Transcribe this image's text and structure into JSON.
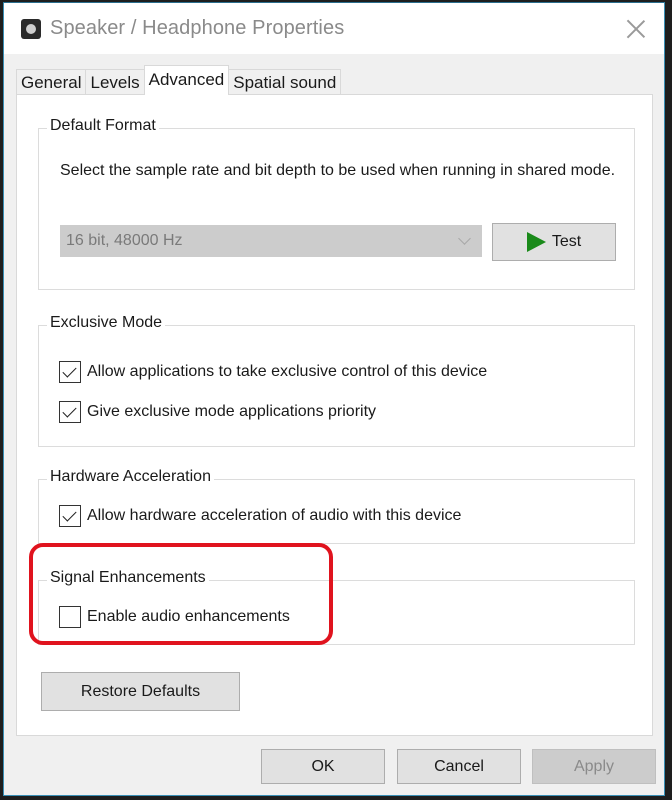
{
  "window": {
    "title": "Speaker / Headphone Properties",
    "icon": "speaker-icon",
    "close_icon": "close-icon"
  },
  "tabs": [
    {
      "label": "General",
      "active": false
    },
    {
      "label": "Levels",
      "active": false
    },
    {
      "label": "Advanced",
      "active": true
    },
    {
      "label": "Spatial sound",
      "active": false
    }
  ],
  "default_format": {
    "label": "Default Format",
    "description": "Select the sample rate and bit depth to be used when running in shared mode.",
    "select_value": "16 bit, 48000 Hz",
    "select_disabled": true,
    "test_label": "Test",
    "test_icon": "play-icon",
    "test_icon_color": "#1a8a1a"
  },
  "exclusive_mode": {
    "label": "Exclusive Mode",
    "options": [
      {
        "label": "Allow applications to take exclusive control of this device",
        "checked": true
      },
      {
        "label": "Give exclusive mode applications priority",
        "checked": true
      }
    ]
  },
  "hardware_acceleration": {
    "label": "Hardware Acceleration",
    "options": [
      {
        "label": "Allow hardware acceleration of audio with this device",
        "checked": true
      }
    ]
  },
  "signal_enhancements": {
    "label": "Signal Enhancements",
    "options": [
      {
        "label": "Enable audio enhancements",
        "checked": false
      }
    ],
    "highlighted": true,
    "highlight_color": "#e0131e"
  },
  "restore_defaults_label": "Restore Defaults",
  "footer": {
    "ok_label": "OK",
    "cancel_label": "Cancel",
    "apply_label": "Apply",
    "apply_disabled": true
  }
}
